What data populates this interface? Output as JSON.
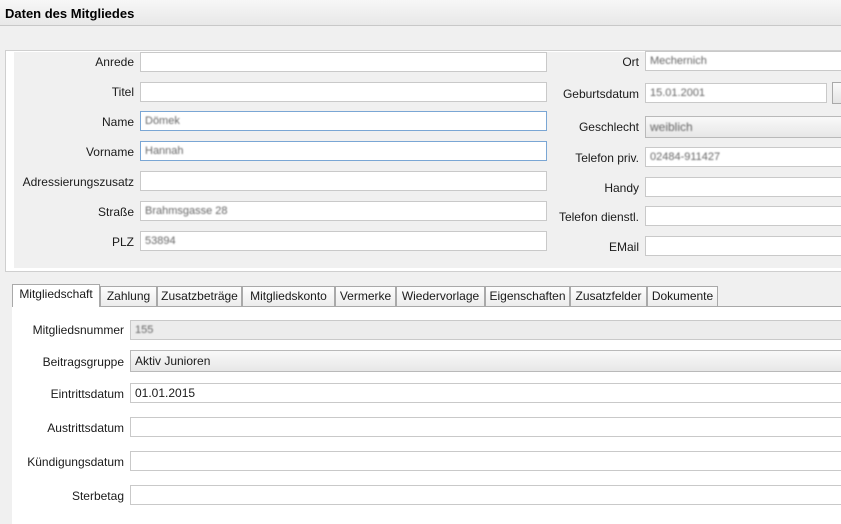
{
  "window": {
    "title": "Daten des Mitgliedes"
  },
  "person": {
    "anrede": {
      "label": "Anrede",
      "value": ""
    },
    "titel": {
      "label": "Titel",
      "value": ""
    },
    "name": {
      "label": "Name",
      "value": "Dömek"
    },
    "vorname": {
      "label": "Vorname",
      "value": "Hannah"
    },
    "adressierungszusatz": {
      "label": "Adressierungszusatz",
      "value": ""
    },
    "strasse": {
      "label": "Straße",
      "value": "Brahmsgasse 28"
    },
    "plz": {
      "label": "PLZ",
      "value": "53894"
    },
    "ort": {
      "label": "Ort",
      "value": "Mechernich"
    },
    "geburtsdatum": {
      "label": "Geburtsdatum",
      "value": "15.01.2001"
    },
    "geschlecht": {
      "label": "Geschlecht",
      "value": "weiblich"
    },
    "telefon_priv": {
      "label": "Telefon priv.",
      "value": "02484-911427"
    },
    "handy": {
      "label": "Handy",
      "value": ""
    },
    "telefon_dienstl": {
      "label": "Telefon dienstl.",
      "value": ""
    },
    "email": {
      "label": "EMail",
      "value": ""
    }
  },
  "tabs": [
    {
      "label": "Mitgliedschaft",
      "active": true
    },
    {
      "label": "Zahlung"
    },
    {
      "label": "Zusatzbeträge"
    },
    {
      "label": "Mitgliedskonto"
    },
    {
      "label": "Vermerke"
    },
    {
      "label": "Wiedervorlage"
    },
    {
      "label": "Eigenschaften"
    },
    {
      "label": "Zusatzfelder"
    },
    {
      "label": "Dokumente"
    }
  ],
  "membership": {
    "mitgliedsnummer": {
      "label": "Mitgliedsnummer",
      "value": "155"
    },
    "beitragsgruppe": {
      "label": "Beitragsgruppe",
      "value": "Aktiv Junioren"
    },
    "eintrittsdatum": {
      "label": "Eintrittsdatum",
      "value": "01.01.2015"
    },
    "austrittsdatum": {
      "label": "Austrittsdatum",
      "value": ""
    },
    "kuendigungsdatum": {
      "label": "Kündigungsdatum",
      "value": ""
    },
    "sterbetag": {
      "label": "Sterbetag",
      "value": ""
    }
  }
}
